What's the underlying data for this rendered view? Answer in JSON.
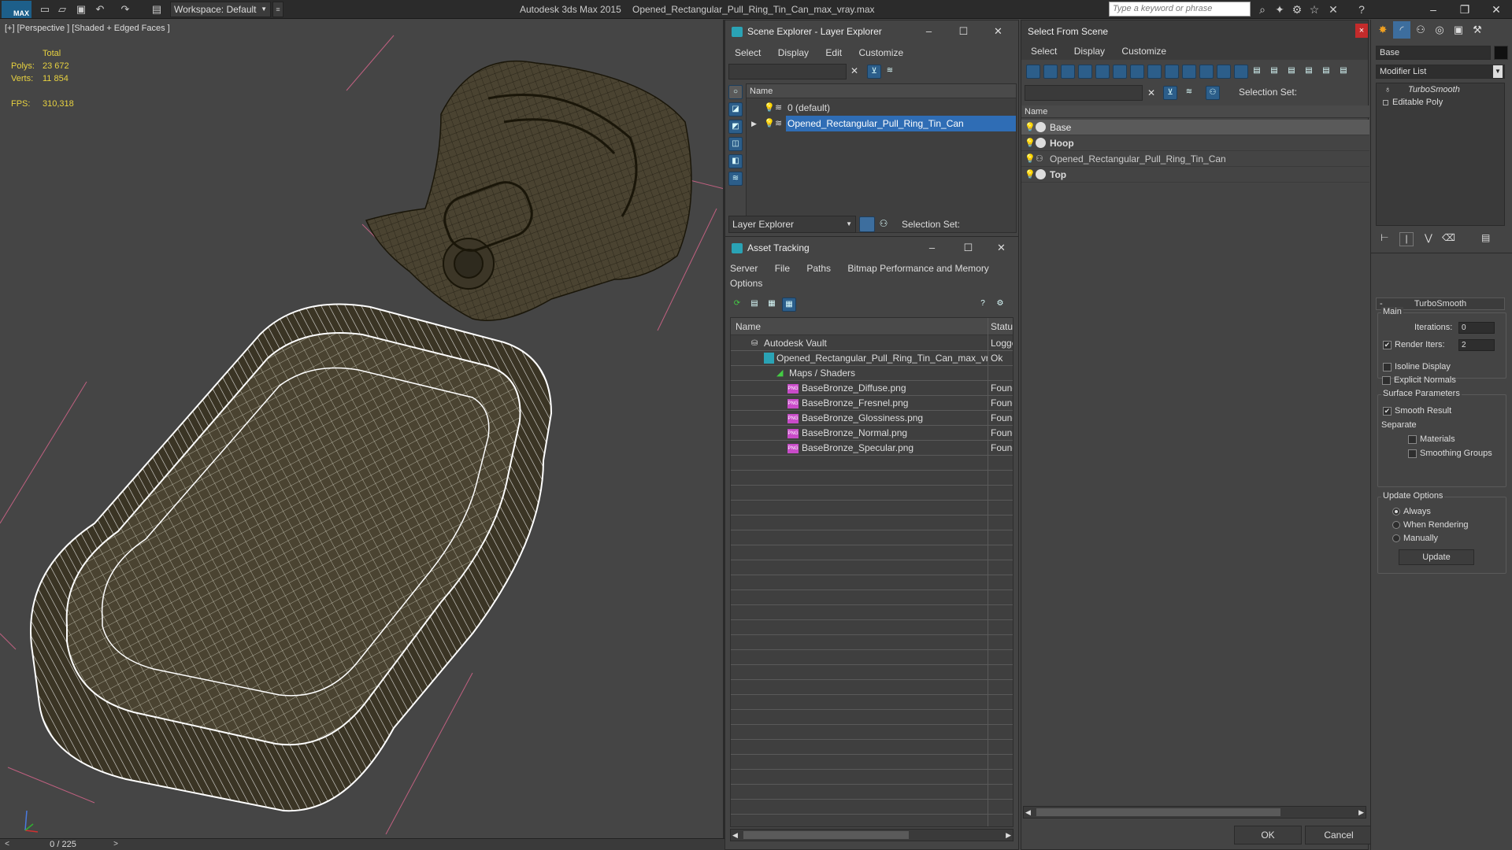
{
  "titlebar": {
    "logo_text": "MAX",
    "workspace_label": "Workspace: Default",
    "app_title": "Autodesk 3ds Max  2015",
    "file_name": "Opened_Rectangular_Pull_Ring_Tin_Can_max_vray.max",
    "search_placeholder": "Type a keyword or phrase"
  },
  "viewport": {
    "label": "[+] [Perspective ] [Shaded + Edged Faces ]",
    "stats": {
      "total_label": "Total",
      "polys_label": "Polys:",
      "polys_value": "23 672",
      "verts_label": "Verts:",
      "verts_value": "11 854",
      "fps_label": "FPS:",
      "fps_value": "310,318"
    }
  },
  "timeline": {
    "frame": "0 / 225",
    "prev": "<",
    "next": ">"
  },
  "scene_explorer": {
    "title": "Scene Explorer - Layer Explorer",
    "menu": [
      "Select",
      "Display",
      "Edit",
      "Customize"
    ],
    "column_name": "Name",
    "rows": [
      "0 (default)",
      "Opened_Rectangular_Pull_Ring_Tin_Can"
    ],
    "footer_mode": "Layer Explorer",
    "selection_set_label": "Selection Set:"
  },
  "asset_tracking": {
    "title": "Asset Tracking",
    "menu": [
      "Server",
      "File",
      "Paths",
      "Bitmap Performance and Memory"
    ],
    "menu2": "Options",
    "col_name": "Name",
    "col_status": "Status",
    "rows": [
      {
        "name": "Autodesk Vault",
        "status": "Logged"
      },
      {
        "name": "Opened_Rectangular_Pull_Ring_Tin_Can_max_vr...",
        "status": "Ok"
      },
      {
        "name": "Maps / Shaders",
        "status": ""
      },
      {
        "name": "BaseBronze_Diffuse.png",
        "status": "Found"
      },
      {
        "name": "BaseBronze_Fresnel.png",
        "status": "Found"
      },
      {
        "name": "BaseBronze_Glossiness.png",
        "status": "Found"
      },
      {
        "name": "BaseBronze_Normal.png",
        "status": "Found"
      },
      {
        "name": "BaseBronze_Specular.png",
        "status": "Found"
      }
    ]
  },
  "select_from_scene": {
    "title": "Select From Scene",
    "menu": [
      "Select",
      "Display",
      "Customize"
    ],
    "selection_set_label": "Selection Set:",
    "column_name": "Name",
    "rows": [
      "Base",
      "Hoop",
      "Opened_Rectangular_Pull_Ring_Tin_Can",
      "Top"
    ],
    "ok_label": "OK",
    "cancel_label": "Cancel"
  },
  "command_panel": {
    "object_name": "Base",
    "modifier_list": "Modifier List",
    "stack": [
      "TurboSmooth",
      "Editable Poly"
    ],
    "turbosmooth": {
      "title": "TurboSmooth",
      "main_label": "Main",
      "iterations_label": "Iterations:",
      "iterations_value": "0",
      "render_iters_label": "Render Iters:",
      "render_iters_value": "2",
      "isoline_label": "Isoline Display",
      "explicit_normals_label": "Explicit Normals",
      "surface_params_label": "Surface Parameters",
      "smooth_result_label": "Smooth Result",
      "separate_label": "Separate",
      "materials_label": "Materials",
      "smoothing_groups_label": "Smoothing Groups",
      "update_options_label": "Update Options",
      "always_label": "Always",
      "when_rendering_label": "When Rendering",
      "manually_label": "Manually",
      "update_button": "Update"
    }
  },
  "colors": {
    "accent": "#2f6db5",
    "stats_yellow": "#e8d240",
    "mesh_fill": "#4a4331"
  }
}
